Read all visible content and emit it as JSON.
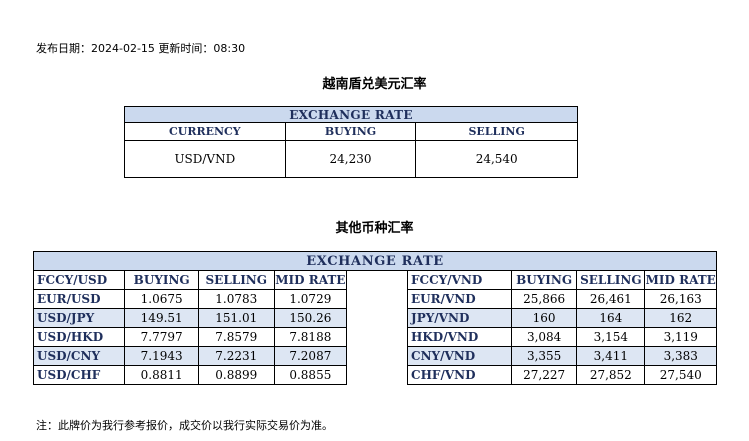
{
  "publish_line": "发布日期：2024-02-15 更新时间：08:30",
  "section1_title": "越南盾兑美元汇率",
  "table1": {
    "header": "EXCHANGE RATE",
    "columns": [
      "CURRENCY",
      "BUYING",
      "SELLING"
    ],
    "row": [
      "USD/VND",
      "24,230",
      "24,540"
    ]
  },
  "section2_title": "其他币种汇率",
  "table2": {
    "header": "EXCHANGE  RATE",
    "left_columns": [
      "FCCY/USD",
      "BUYING",
      "SELLING",
      "MID RATE"
    ],
    "right_columns": [
      "FCCY/VND",
      "BUYING",
      "SELLING",
      "MID RATE"
    ],
    "rows": [
      {
        "lpair": "EUR/USD",
        "lbuy": "1.0675",
        "lsell": "1.0783",
        "lmid": "1.0729",
        "rpair": "EUR/VND",
        "rbuy": "25,866",
        "rsell": "26,461",
        "rmid": "26,163"
      },
      {
        "lpair": "USD/JPY",
        "lbuy": "149.51",
        "lsell": "151.01",
        "lmid": "150.26",
        "rpair": "JPY/VND",
        "rbuy": "160",
        "rsell": "164",
        "rmid": "162"
      },
      {
        "lpair": "USD/HKD",
        "lbuy": "7.7797",
        "lsell": "7.8579",
        "lmid": "7.8188",
        "rpair": "HKD/VND",
        "rbuy": "3,084",
        "rsell": "3,154",
        "rmid": "3,119"
      },
      {
        "lpair": "USD/CNY",
        "lbuy": "7.1943",
        "lsell": "7.2231",
        "lmid": "7.2087",
        "rpair": "CNY/VND",
        "rbuy": "3,355",
        "rsell": "3,411",
        "rmid": "3,383"
      },
      {
        "lpair": "USD/CHF",
        "lbuy": "0.8811",
        "lsell": "0.8899",
        "lmid": "0.8855",
        "rpair": "CHF/VND",
        "rbuy": "27,227",
        "rsell": "27,852",
        "rmid": "27,540"
      }
    ]
  },
  "footnote": "注：此牌价为我行参考报价，成交价以我行实际交易价为准。",
  "colors": {
    "header_bg": "#cbd9ee",
    "alt_row_bg": "#dde6f3",
    "header_text": "#1f2f5c"
  }
}
